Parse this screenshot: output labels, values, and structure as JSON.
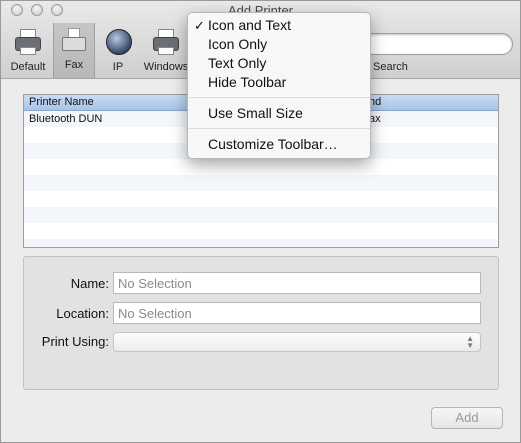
{
  "window": {
    "title": "Add Printer"
  },
  "toolbar": {
    "items": [
      {
        "label": "Default",
        "icon": "printer-icon"
      },
      {
        "label": "Fax",
        "icon": "fax-icon"
      },
      {
        "label": "IP",
        "icon": "globe-icon"
      },
      {
        "label": "Windows",
        "icon": "windows-printer-icon"
      }
    ],
    "search_label": "Search",
    "selected": "Fax"
  },
  "printer_list": {
    "columns": [
      "Printer Name",
      "Kind"
    ],
    "visible_columns": [
      "Printer Name",
      "nd"
    ],
    "rows": [
      {
        "name": "Bluetooth DUN",
        "kind": "ax"
      }
    ]
  },
  "form": {
    "name_label": "Name:",
    "name_value": "No Selection",
    "location_label": "Location:",
    "location_value": "No Selection",
    "print_using_label": "Print Using:",
    "print_using_value": ""
  },
  "add_button": {
    "label": "Add",
    "enabled": false
  },
  "context_menu": {
    "items": [
      {
        "label": "Icon and Text",
        "checked": true
      },
      {
        "label": "Icon Only"
      },
      {
        "label": "Text Only"
      },
      {
        "label": "Hide Toolbar"
      },
      {
        "label": "Use Small Size"
      },
      {
        "label": "Customize Toolbar…"
      }
    ]
  }
}
